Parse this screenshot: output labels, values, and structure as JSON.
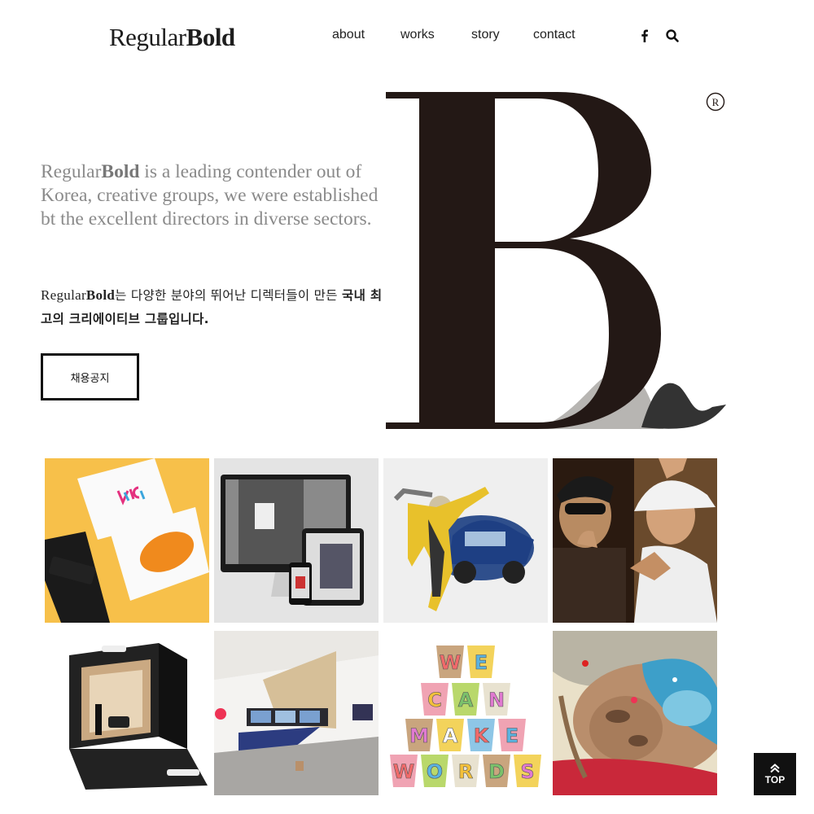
{
  "header": {
    "logo_regular": "Regular",
    "logo_bold": "Bold",
    "nav": [
      {
        "label": "about"
      },
      {
        "label": "works"
      },
      {
        "label": "story"
      },
      {
        "label": "contact"
      }
    ],
    "icons": [
      "facebook-icon",
      "search-icon"
    ]
  },
  "intro": {
    "en_brand_regular": "Regular",
    "en_brand_bold": "Bold",
    "en_text": " is a leading contender out of Korea, creative groups, we were established bt the excellent directors in diverse sectors.",
    "ko_brand_regular": "Regular",
    "ko_brand_bold": "Bold",
    "ko_text_1": "는 다양한 분야의 뛰어난 디렉터들이 만든 ",
    "ko_text_2": "국내 최고의 크리에이티브 그룹입니다.",
    "recruit_label": "채용공지"
  },
  "hero": {
    "letter": "B",
    "registered_mark": "R"
  },
  "works": [
    {
      "name": "jtbc-business-cards"
    },
    {
      "name": "research-center-web"
    },
    {
      "name": "hero-car-illustration"
    },
    {
      "name": "music-video-portrait"
    },
    {
      "name": "cosmetic-package"
    },
    {
      "name": "exhibition-space"
    },
    {
      "name": "we-can-make-words-cups"
    },
    {
      "name": "surreal-beach-illustration"
    }
  ],
  "cups": {
    "row1": [
      "W",
      "E"
    ],
    "row2": [
      "C",
      "A",
      "N"
    ],
    "row3": [
      "M",
      "A",
      "K",
      "E"
    ],
    "row4": [
      "W",
      "O",
      "R",
      "D",
      "S"
    ]
  },
  "top_button": {
    "label": "TOP"
  },
  "colors": {
    "text": "#222222",
    "muted": "#8a8a8a",
    "hero_dark": "#231815",
    "hero_gray": "#b5b5b5"
  }
}
